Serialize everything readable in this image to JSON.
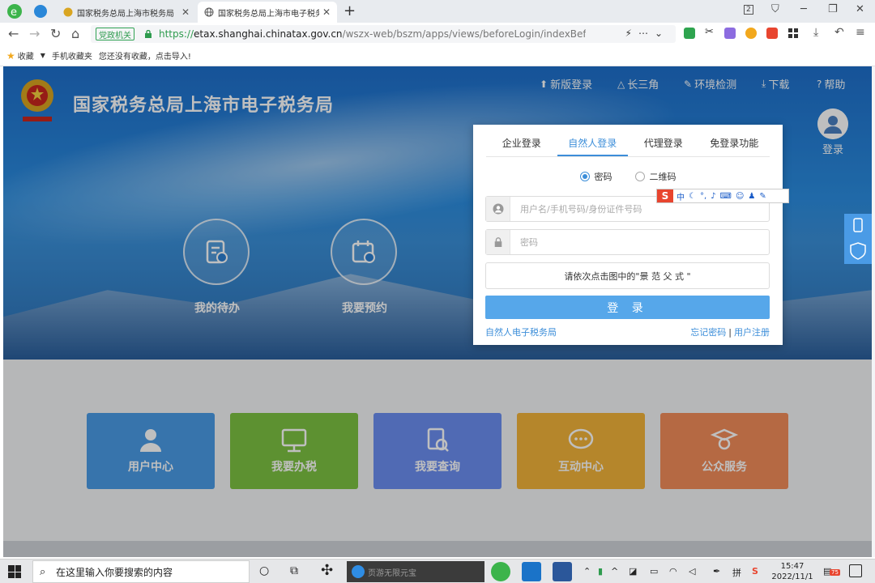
{
  "browser": {
    "tabs": [
      {
        "title": "国家税务总局上海市税务局"
      },
      {
        "title": "国家税务总局上海市电子税务"
      }
    ],
    "new_tab": "+",
    "tab_count": "2",
    "address": {
      "security_badge": "党政机关",
      "scheme": "https://",
      "host": "etax.shanghai.chinatax.gov.cn",
      "path": "/wszx-web/bszm/apps/views/beforeLogin/indexBefore/pageIndex."
    },
    "bookmarks": {
      "favorites_label": "收藏",
      "mobile_label": "手机收藏夹",
      "import_hint": "您还没有收藏，点击导入!"
    }
  },
  "site": {
    "title": "国家税务总局上海市电子税务局",
    "top_nav": [
      {
        "label": "新版登录"
      },
      {
        "label": "长三角"
      },
      {
        "label": "环境检测"
      },
      {
        "label": "下载"
      },
      {
        "label": "帮助"
      }
    ],
    "user_label": "登录",
    "circle_buttons": [
      {
        "label": "我的待办"
      },
      {
        "label": "我要预约"
      }
    ],
    "tiles": [
      {
        "label": "用户中心",
        "color": "#4a9be6"
      },
      {
        "label": "我要办税",
        "color": "#7cc242"
      },
      {
        "label": "我要查询",
        "color": "#6b8ef0"
      },
      {
        "label": "互动中心",
        "color": "#f2b33a"
      },
      {
        "label": "公众服务",
        "color": "#f28c5a"
      }
    ]
  },
  "login": {
    "tabs": [
      {
        "label": "企业登录"
      },
      {
        "label": "自然人登录"
      },
      {
        "label": "代理登录"
      },
      {
        "label": "免登录功能"
      }
    ],
    "radio_password": "密码",
    "radio_qr": "二维码",
    "username_placeholder": "用户名/手机号码/身份证件号码",
    "password_placeholder": "密码",
    "captcha_text": "请依次点击图中的\"景 范 父 式 \"",
    "submit_label": "登 录",
    "link_left": "自然人电子税务局",
    "link_forgot": "忘记密码",
    "link_sep": "|",
    "link_register": "用户注册"
  },
  "ime": {
    "logo": "S",
    "mode": "中"
  },
  "taskbar": {
    "search_placeholder": "在这里输入你要搜索的内容",
    "dark_app_text": "页游无限元宝",
    "time": "15:47",
    "date": "2022/11/1",
    "notif_badge": "75"
  },
  "colors": {
    "accent": "#3c8ed9",
    "login_button": "#56a7ea",
    "secure_green": "#2e9b4e"
  }
}
